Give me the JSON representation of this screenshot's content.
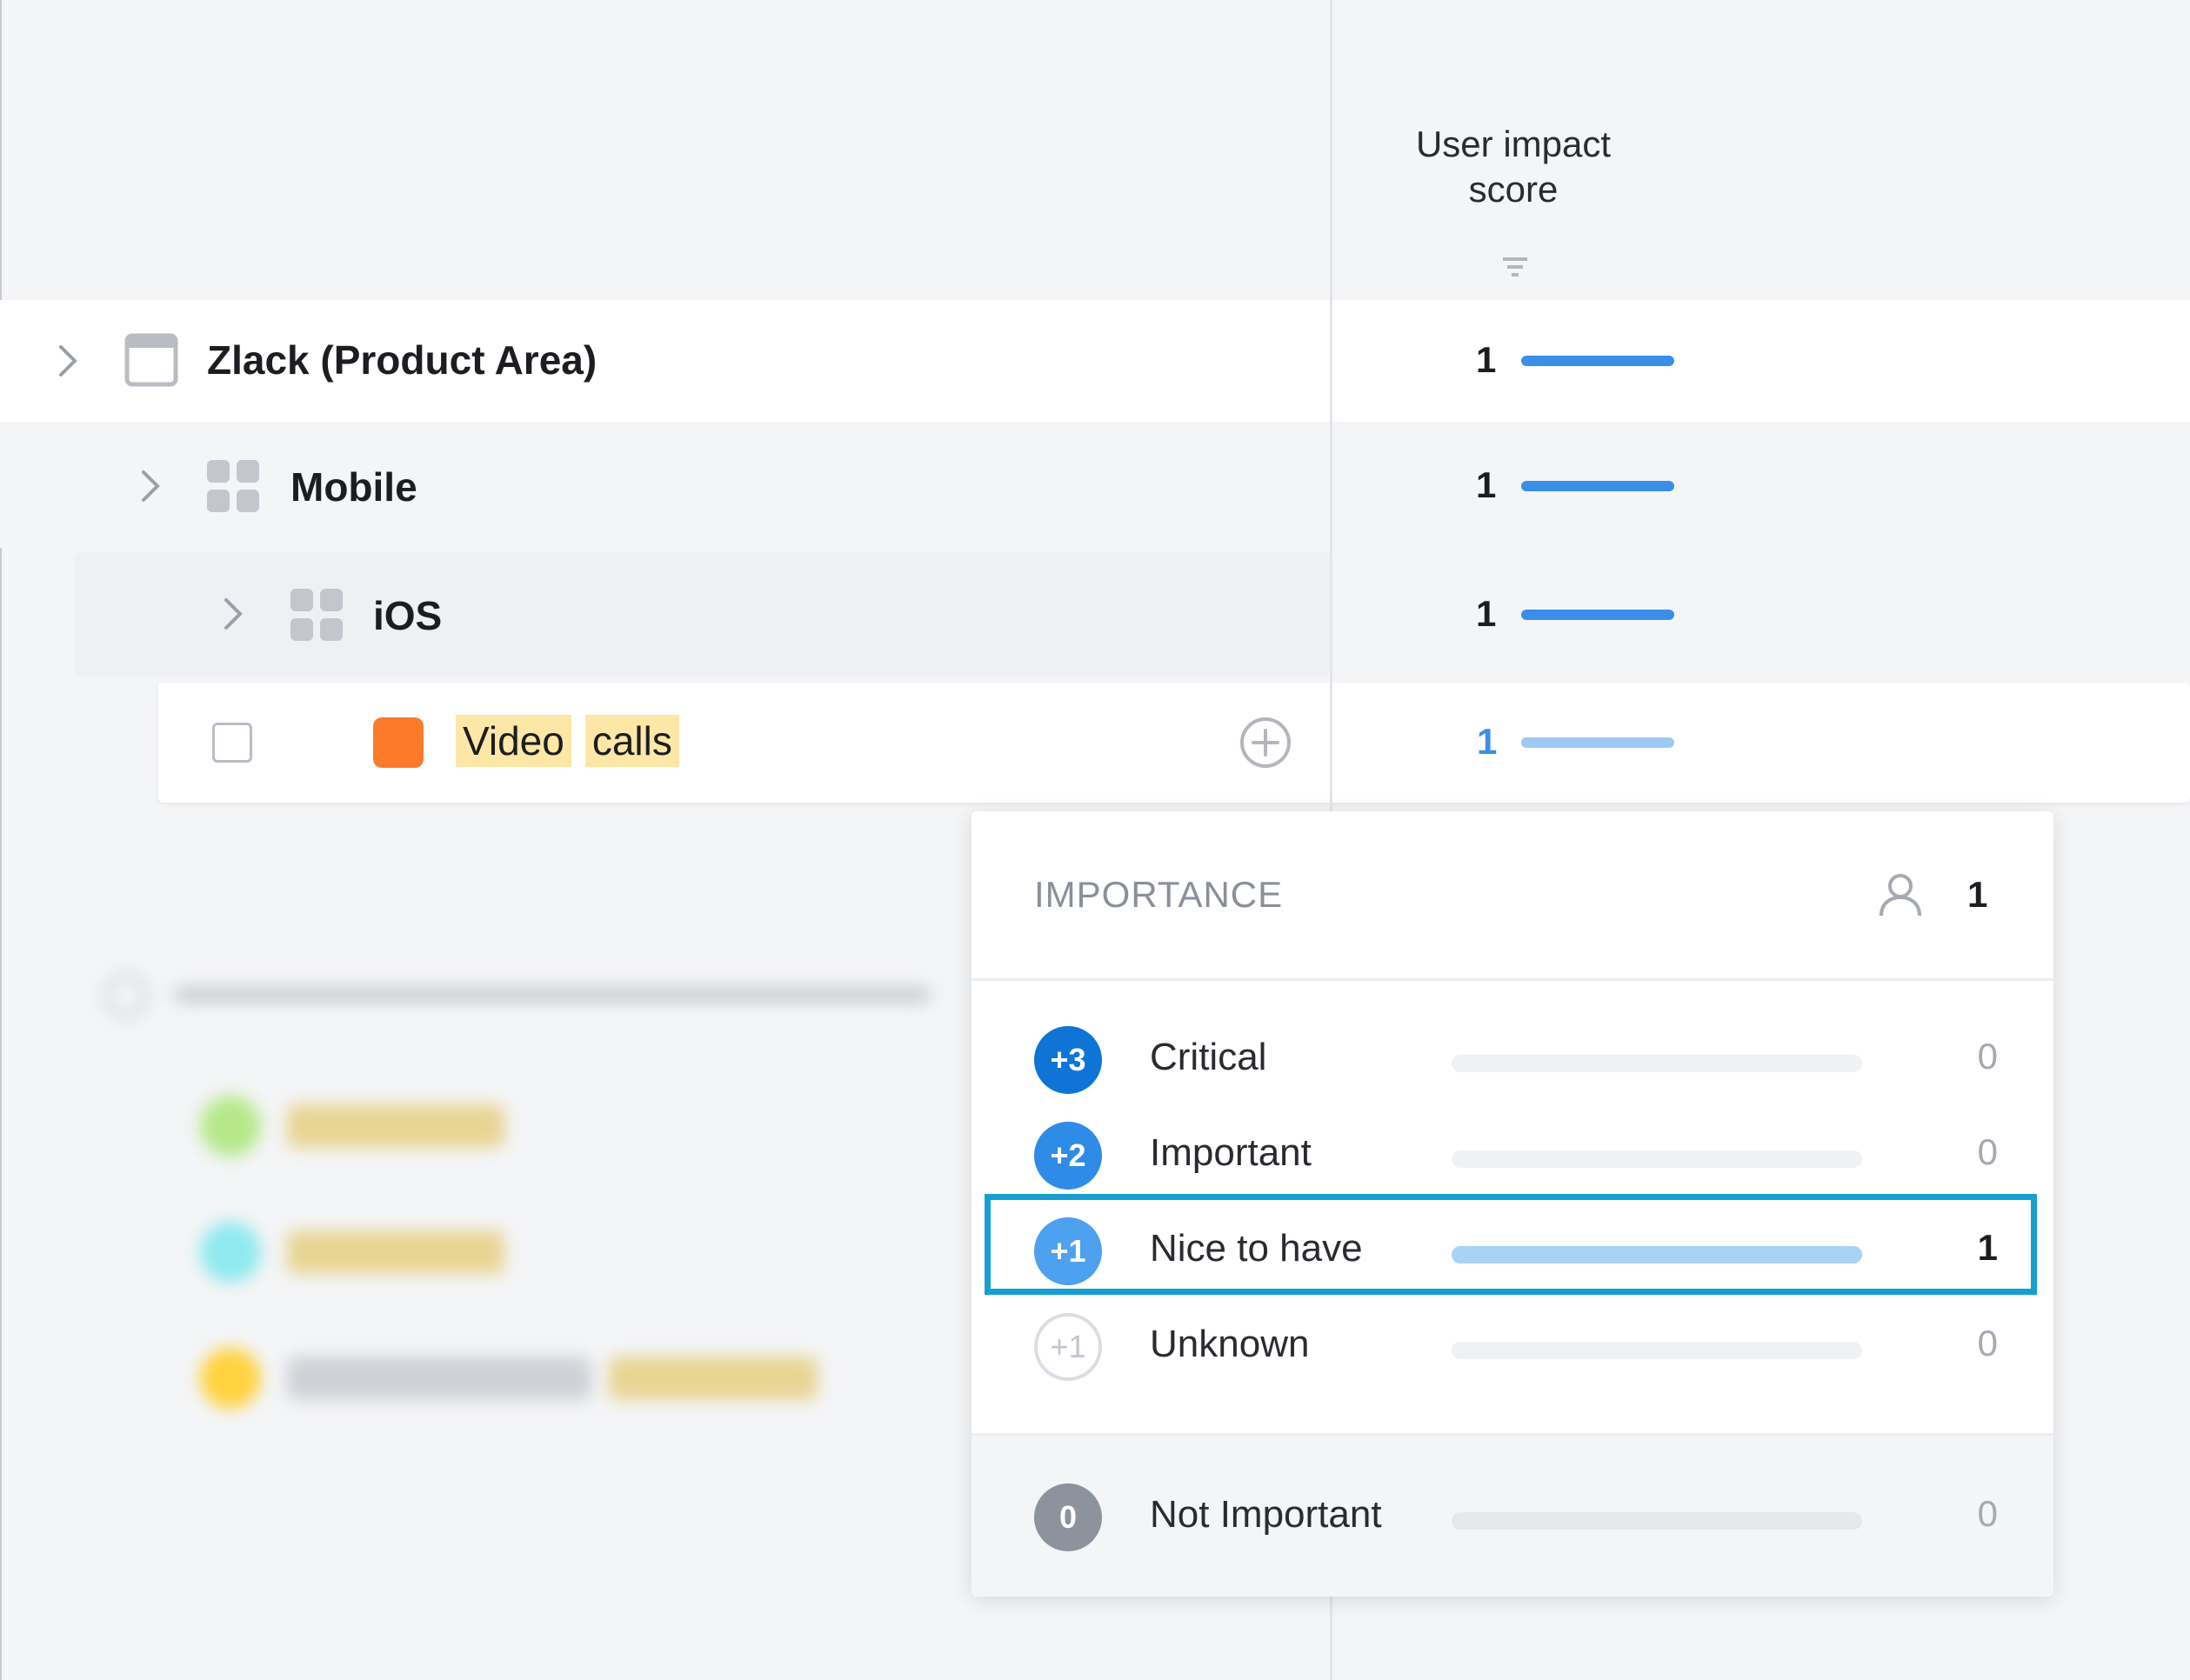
{
  "header": {
    "column_title": "User impact score",
    "column_title_line1": "User impact",
    "column_title_line2": "score"
  },
  "rows": [
    {
      "label": "Zlack (Product Area)",
      "score": "1"
    },
    {
      "label": "Mobile",
      "score": "1"
    },
    {
      "label": "iOS",
      "score": "1"
    },
    {
      "label_word1": "Video",
      "label_word2": "calls",
      "score": "1"
    }
  ],
  "popup": {
    "title": "IMPORTANCE",
    "voter_count": "1",
    "options": [
      {
        "badge": "+3",
        "label": "Critical",
        "count": "0",
        "fill": 0
      },
      {
        "badge": "+2",
        "label": "Important",
        "count": "0",
        "fill": 0
      },
      {
        "badge": "+1",
        "label": "Nice to have",
        "count": "1",
        "fill": 1
      },
      {
        "badge": "+1",
        "label": "Unknown",
        "count": "0",
        "fill": 0
      }
    ],
    "footer": {
      "badge": "0",
      "label": "Not Important",
      "count": "0",
      "fill": 0
    }
  },
  "colors": {
    "accent": "#3b8ee8",
    "highlight": "#159fd3",
    "feature": "#fb7b2a"
  }
}
